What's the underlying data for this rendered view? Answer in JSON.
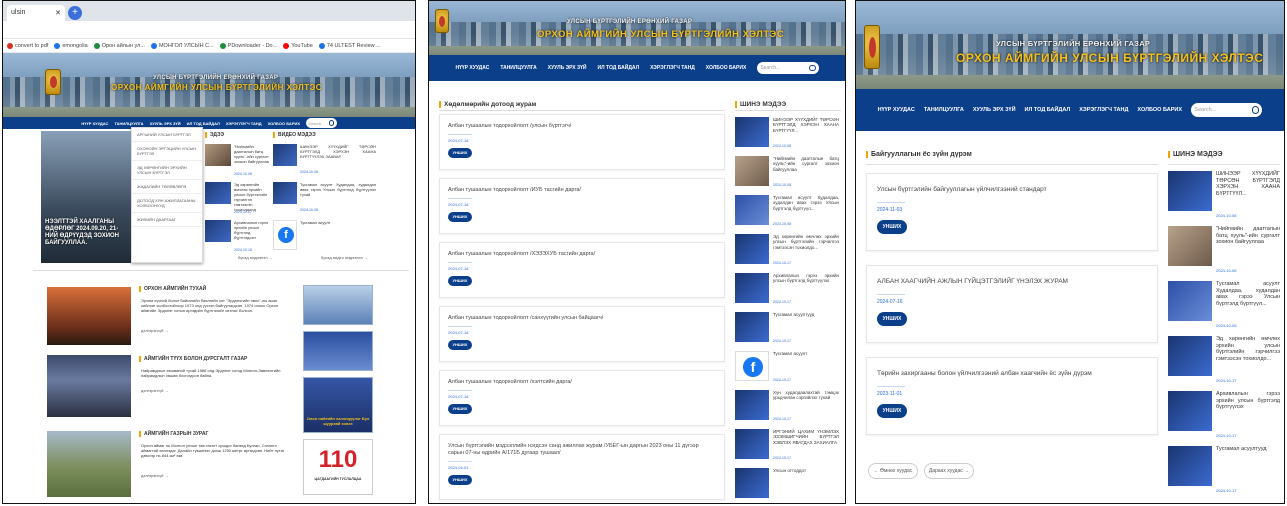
{
  "browser": {
    "tab_title": "ulsin",
    "new_tab_symbol": "+",
    "bookmarks": [
      {
        "label": "convert to pdf",
        "color": "#d93025"
      },
      {
        "label": "emongolia",
        "color": "#1a73e8"
      },
      {
        "label": "Орон айлын ул...",
        "color": "#1e8e3e"
      },
      {
        "label": "МОНГОЛ УЛСЫН С...",
        "color": "#1a73e8"
      },
      {
        "label": "PDownloader - Do...",
        "color": "#1e8e3e"
      },
      {
        "label": "YouTube",
        "color": "#ff0000"
      },
      {
        "label": "74 ULTEST Review ...",
        "color": "#1a73e8"
      }
    ]
  },
  "site": {
    "title_line1": "УЛСЫН БҮРТГЭЛИЙН ЕРӨНХИЙ ГАЗАР",
    "title_line2": "ОРХОН АЙМГИЙН УЛСЫН БҮРТГЭЛИЙН ХЭЛТЭС",
    "nav": [
      "НҮҮР ХУУДАС",
      "ТАНИЛЦУУЛГА",
      "ХУУЛЬ ЭРХ ЗҮЙ",
      "ИЛ ТОД БАЙДАЛ",
      "ХЭРЭГЛЭГЧ ТАНД",
      "ХОЛБОО БАРИХ"
    ],
    "search_placeholder": "Search...",
    "brand_color": "#0b3f8a",
    "accent_color": "#f5c21b"
  },
  "panel1": {
    "dropdown_items": [
      "АРГЫНИЙ УЛСЫН БҮРТГЭЛ",
      "ОХОНОЙН ЭРГЭЦИЙН УЛСЫН БҮРТГЭЛ",
      "ЭД ХӨРӨНГИЙН ЭРХИЙН УЛСЫН БҮРТГЭЛ",
      "ЖАДАЛИЙН ТӨЛӨВЛӨГӨ",
      "ДОТООД ХЯН АЖИЛЛАГААНЫ ХОЛБООНУУД",
      "ЖИЛИЙН ДААРГААГ"
    ],
    "hero_text": "НЭЭЛТТЭЙ ХААЛГАНЫ ӨДӨРЛӨГ 2024.09.20, 21-НИЙ ӨДРҮҮДЭД ЗОХИОН БАЙГУУЛЛАА.",
    "news_head": "ЭДЭЭ",
    "video_head": "ВИДЕО МЭДЭЭ",
    "news": [
      {
        "text": "\"Нийгмийн даатгалын батц хууль\"-ийн сургалт зохион байгууллаа",
        "date": "2024-10-08"
      },
      {
        "text": "Эд хөрөнгийн өмчлөх эрхийн улсын бүртгэлийн гэрчилгээ гэмтээсэн тохиолдолд",
        "date": "2024-10-17"
      },
      {
        "text": "Архивлалын гэрээ эрхийн улсын бүртгэлд бүртгэгдсэн",
        "date": "2024-10-15"
      }
    ],
    "videos": [
      {
        "text": "ШИНЭЭР ХҮҮХДИЙГ ТӨРСӨН БҮРТГЭЛД ХЭРХЭН ХААНА БҮРТГҮҮЛЭХ ЗААВАР",
        "date": "2024-10-08"
      },
      {
        "text": "Тусгамал асуулт Худалдаа, худалдан авах гэрээ Улсын бүртгэлд бүртгүүлэх тухай",
        "date": "2024-10-08"
      },
      {
        "text": "Тусгамал асуулт",
        "date": ""
      }
    ],
    "more_news": "бусад мэдээлэл →",
    "more_videos": "бусад видео мэдээлэл →",
    "sections": [
      {
        "title": "ОРХОН АЙМГИЙН ТУХАЙ",
        "text": "Эрчим хүчний болон байгалийн баялгийн хот \"Эрдэнэтийн овоо\"-ны ашиг хийгээн холбоотойгоор 1973 онд үүсгэн байгуулагдсан. 1974 оноос Орхон аймгийн Эрдэнэт хотын иргэдийн бүртгэлийг хөтлөх болсон.",
        "more": "дэлгэрэнгүй →"
      },
      {
        "title": "АЙМГИЙН ТҮҮХ БОЛОН ДУРСГАЛТ ГАЗАР",
        "text": "Найрамдлын хөшөөний тухай 1986 онд Эрдэнэт хотод Монгол-Зөвлөлтийн найрамдлын хөшөө босгогдсон байна.",
        "more": "дэлгэрэнгүй →"
      },
      {
        "title": "АЙМГИЙН ГАЗРЫН ЗУРАГ",
        "text": "Орхон аймаг нь Монгол улсын төв хэсэгт оршдог бөгөөд Булган, Сэлэнгэ аймагтай хиллэдэг. Далайн түвшнээс дээш 1250 метрт өргөгдсөн. Нийт нутаг дэвсгэр нь 844 км² юм.",
        "more": "дэлгэрэнгүй →"
      }
    ],
    "side_card_text": "Олон нийтийн хэлэлцүүлэг Бүх шуурхай хэлэх",
    "hotline_number": "110",
    "hotline_label": "ЦАГДААГИЙН ТУСЛАЛЦАА"
  },
  "panel2": {
    "head": "Хөдөлмөрийн дотоод журам",
    "side_head": "ШИНЭ МЭДЭЭ",
    "button_label": "УНШИХ",
    "docs": [
      {
        "title": "Албан тушаалын тодорхойлолт /улсын бүртгэгч/",
        "date": "2024-07-16"
      },
      {
        "title": "Албан тушаалын тодорхойлолт /ИУБ тасгийн дарга/",
        "date": "2024-07-16"
      },
      {
        "title": "Албан тушаалын тодорхойлолт /ХЭЗЭХУБ тасгийн дарга/",
        "date": "2024-07-16"
      },
      {
        "title": "Албан тушаалын тодорхойлолт /санхүүгийн улсын байцаагч/",
        "date": "2024-07-16"
      },
      {
        "title": "Албан тушаалын тодорхойлолт /хэлтсийн дарга/",
        "date": "2024-07-16"
      },
      {
        "title": "Улсын бүртгэлийн мэдээллийн нэгдсэн санд ажиллах журам /УБЕГ-ын даргын 2023 оны 11 дүгээр сарын 07-ны өдрийн А/171Б дугаар тушаал/",
        "date": "2024-04-01"
      }
    ],
    "side_news": [
      {
        "text": "ШИНЭЭР ХҮҮХДИЙГ ТӨРСӨН БҮРТГЭЛД ХЭРХЭН ХААНА БҮРТГҮҮЛ...",
        "date": "2024-10-08"
      },
      {
        "text": "\"Нийгмийн даатгалын батц хууль\"-ийн сургалт зохион байгууллаа",
        "date": "2024-10-08"
      },
      {
        "text": "Тусгамал асуулт Худалдаа, худалдан авах гэрээ Улсын бүртгэлд бүртгүүл...",
        "date": "2024-10-08"
      },
      {
        "text": "Эд хөрөнгийн өмчлөх эрхийн улсын бүртгэлийн гэрчилгээ гэмтээсэн тохиолдо...",
        "date": "2024-10-17"
      },
      {
        "text": "Архивлалын гэрээ эрхийн улсын бүртгэлд бүртгүүлэх",
        "date": "2024-10-17"
      },
      {
        "text": "Тусгамал асуултууд",
        "date": "2024-10-17"
      },
      {
        "text": "Тусгамал асуулт",
        "date": "2024-10-17"
      },
      {
        "text": "Хүн худалдаалахтай тэмцэх урьдчилан сэргийлэх тухай",
        "date": "2024-10-17"
      },
      {
        "text": "ИРГЭНИЙ ЦАХИМ ҮНЭМЛЭХ ЭЗЭМШИГЧИЙН БҮРТГЭЛ ХЭВЛЭХ ЯВАГДАХ ЗАХИАЛГА",
        "date": "2024-10-17"
      },
      {
        "text": "Улсын оттоддот",
        "date": ""
      }
    ]
  },
  "panel3": {
    "head": "Байгууллагын ёс зүйн дүрэм",
    "side_head": "ШИНЭ МЭДЭЭ",
    "button_label": "УНШИХ",
    "docs": [
      {
        "title": "Улсын бүртгэлийн байгууллагын үйлчилгээний стандарт",
        "date": "2024-11-03"
      },
      {
        "title": "АЛБАН ХААГЧИЙН АЖЛЫН ГҮЙЦЭТГЭЛИЙГ ҮНЭЛЭХ ЖУРАМ",
        "date": "2024-07-16"
      },
      {
        "title": "Төрийн захиргааны болон үйлчилгээний албан хаагчийн ёс зүйн дүрэм",
        "date": "2023-11-01"
      }
    ],
    "prev_label": "← Өмнөх хуудас",
    "next_label": "Дараах хуудас →",
    "side_news": [
      {
        "text": "ШИНЭЭР ХҮҮХДИЙГ ТӨРСӨН БҮРТГЭЛД ХЭРХЭН ХААНА БҮРТГҮҮЛ...",
        "date": "2024-10-08"
      },
      {
        "text": "\"Нийгмийн даатгалын батц хууль\"-ийн сургалт зохион байгууллаа",
        "date": "2024-10-08"
      },
      {
        "text": "Тусгамал асуулт Худалдаа, худалдан авах гэрээ Улсын бүртгэлд бүртгүүл...",
        "date": "2024-10-08"
      },
      {
        "text": "Эд хөрөнгийн өмчлөх эрхийн улсын бүртгэлийн гэрчилгээ гэмтээсэн тохиолдо...",
        "date": "2024-10-17"
      },
      {
        "text": "Архивлалын гэрээ эрхийн улсын бүртгэлд бүртгүүлэх",
        "date": "2024-10-17"
      },
      {
        "text": "Тусгамал асуултууд",
        "date": "2024-10-17"
      }
    ]
  }
}
